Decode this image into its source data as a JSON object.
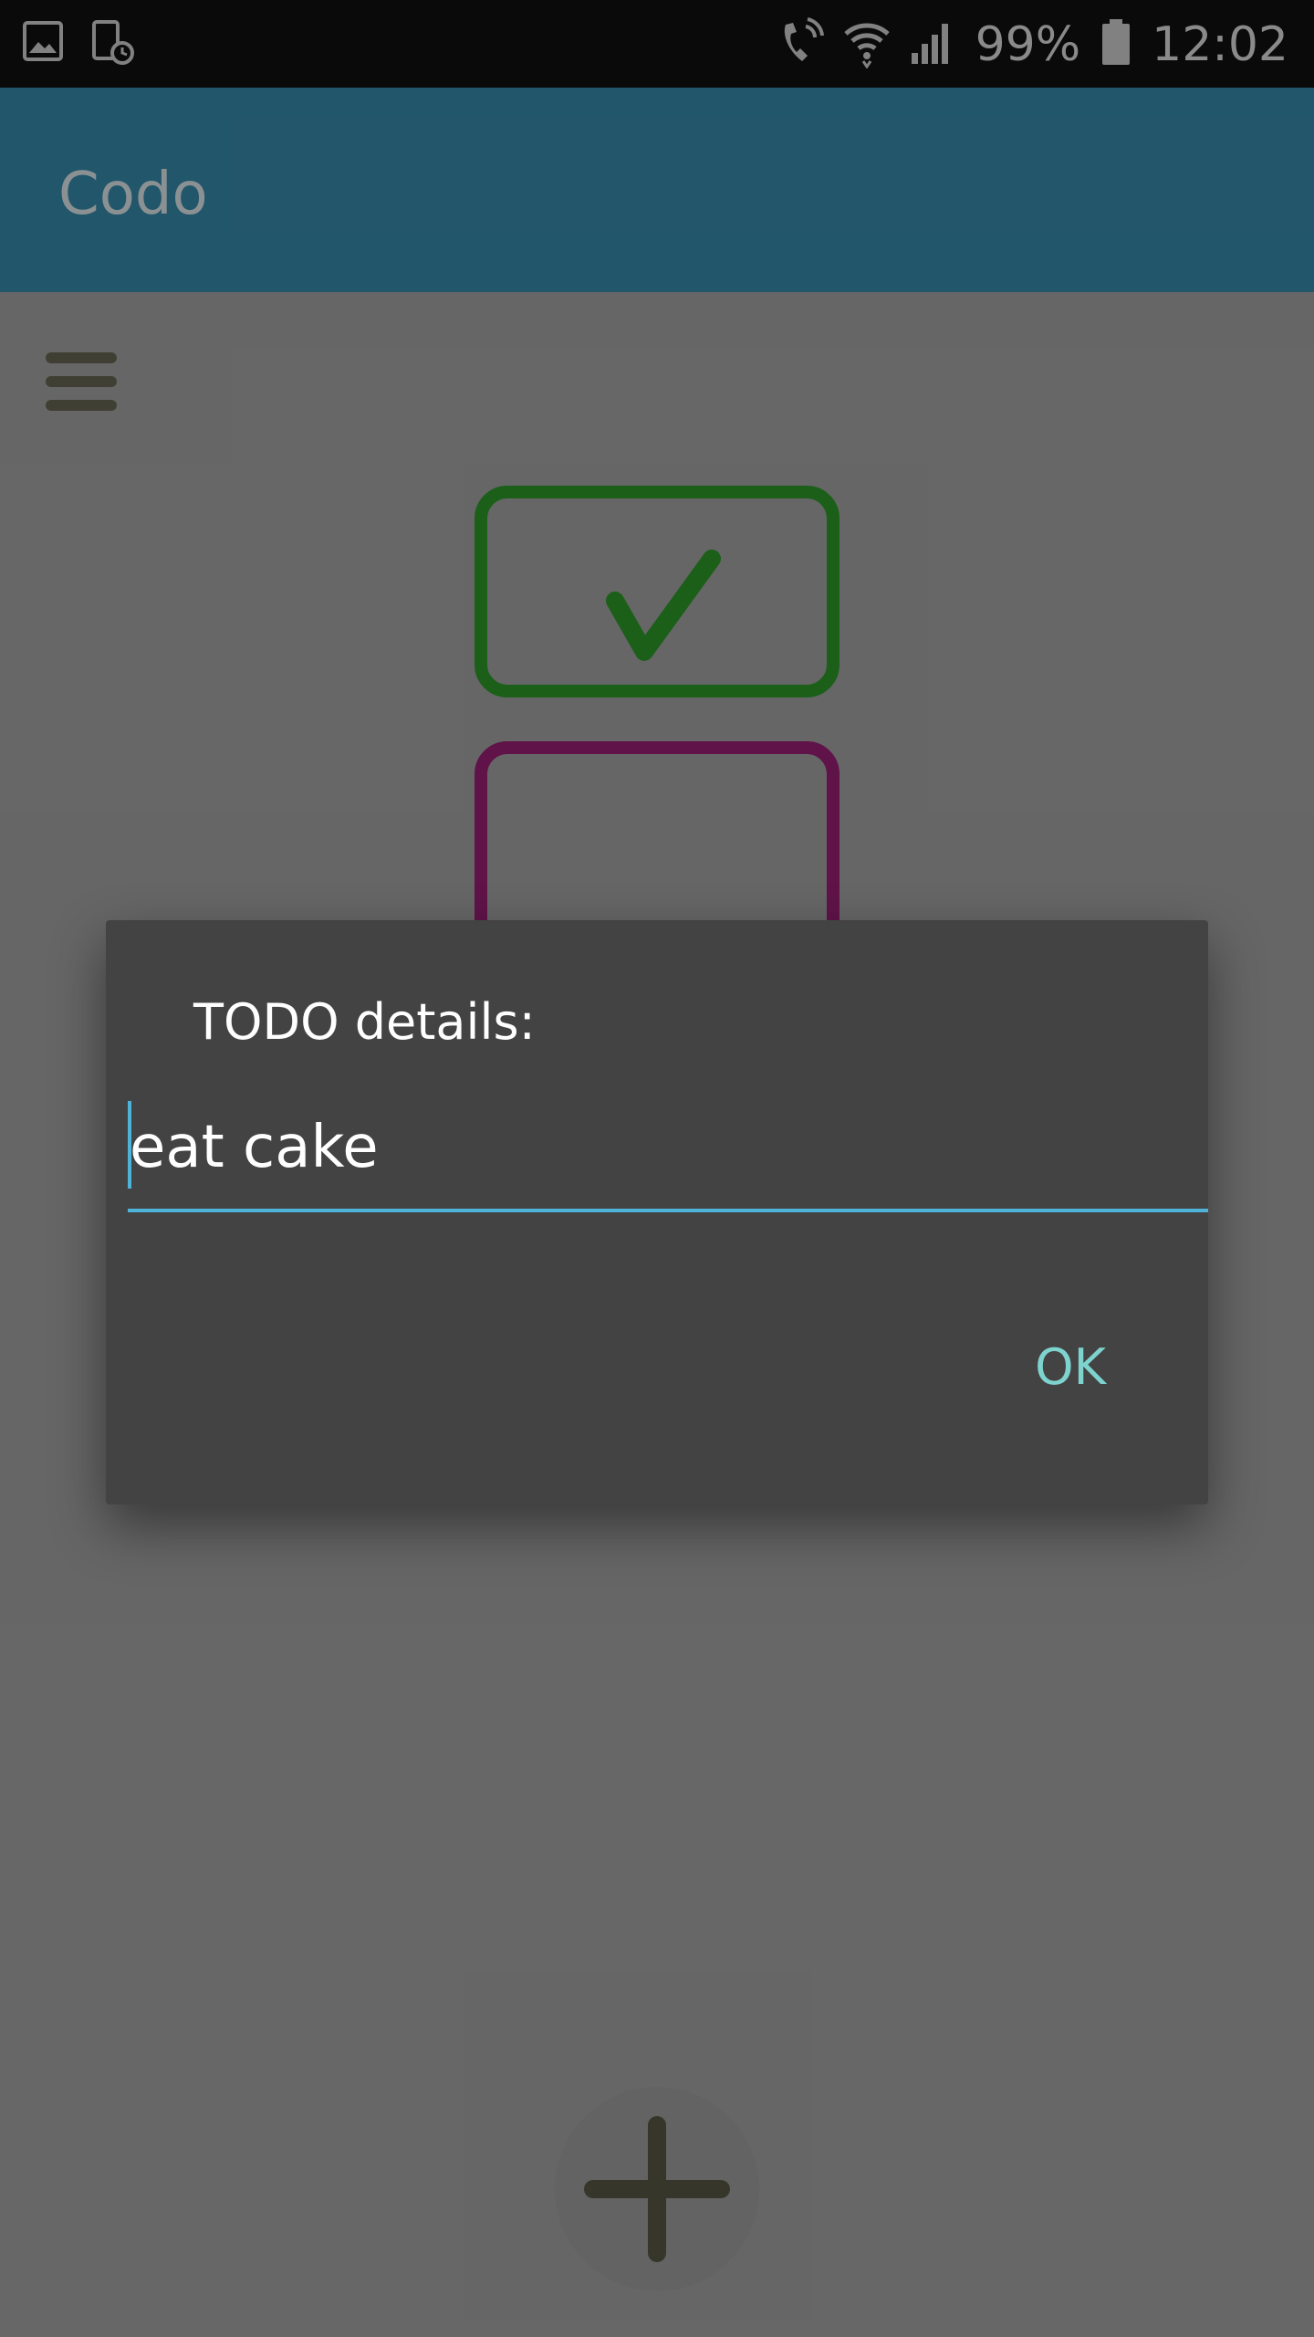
{
  "status_bar": {
    "battery": "99%",
    "time": "12:02",
    "icons": [
      "image-notification-icon",
      "device-schedule-icon",
      "wifi-call-icon",
      "wifi-icon",
      "signal-icon",
      "battery-icon"
    ]
  },
  "app_bar": {
    "title": "Codo",
    "color": "#3a8fb3"
  },
  "content": {
    "menu_icon": "hamburger-menu-icon",
    "todos": [
      {
        "state": "done",
        "color": "#2e9e2a",
        "icon": "checkmark-icon"
      },
      {
        "state": "pending",
        "color": "#a0207a"
      }
    ],
    "fab_icon": "plus-icon"
  },
  "dialog": {
    "title": "TODO details:",
    "input_value": "eat cake",
    "ok_label": "OK",
    "accent": "#4fb3d9"
  }
}
